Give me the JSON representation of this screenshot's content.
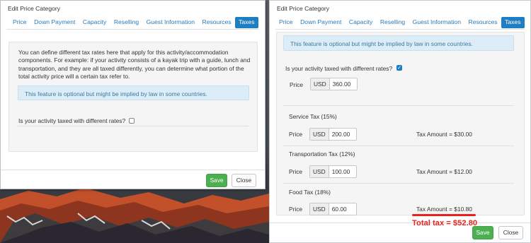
{
  "dialog_left": {
    "title": "Edit Price Category",
    "tabs": [
      "Price",
      "Down Payment",
      "Capacity",
      "Reselling",
      "Guest Information",
      "Resources",
      "Taxes"
    ],
    "active_tab": "Taxes",
    "description": [
      "You can define different tax rates here that apply for this activity/accommodation",
      "components. For example: if your activity consists of a kayak trip with a guide, lunch and",
      "transportation, and they are all taxed differently, you can determine what portion of the",
      "total activity price will a certain tax refer to."
    ],
    "alert": "This feature is optional but might be implied by law in some countries.",
    "question": "Is your activity taxed with different rates?",
    "checked": false,
    "save_label": "Save",
    "close_label": "Close"
  },
  "dialog_right": {
    "title": "Edit Price Category",
    "tabs": [
      "Price",
      "Down Payment",
      "Capacity",
      "Reselling",
      "Guest Information",
      "Resources",
      "Taxes"
    ],
    "active_tab": "Taxes",
    "alert": "This feature is optional but might be implied by law in some countries.",
    "question": "Is your activity taxed with different rates?",
    "checked": true,
    "price": {
      "label": "Price",
      "currency": "USD",
      "value": "360.00"
    },
    "taxes": [
      {
        "title": "Service Tax (15%)",
        "price_label": "Price",
        "currency": "USD",
        "value": "200.00",
        "amount": "Tax Amount = $30.00"
      },
      {
        "title": "Transportation Tax (12%)",
        "price_label": "Price",
        "currency": "USD",
        "value": "100.00",
        "amount": "Tax Amount = $12.00"
      },
      {
        "title": "Food Tax (18%)",
        "price_label": "Price",
        "currency": "USD",
        "value": "60.00",
        "amount": "Tax Amount = $10.80"
      }
    ],
    "total_tax": "Total tax = $52.80",
    "save_label": "Save",
    "close_label": "Close"
  },
  "colors": {
    "accent": "#1f7dc1",
    "save": "#4caf50",
    "annotation": "#e8231d",
    "alert_bg": "#dcedf8"
  },
  "icons": {
    "checkmark": "check-icon"
  }
}
